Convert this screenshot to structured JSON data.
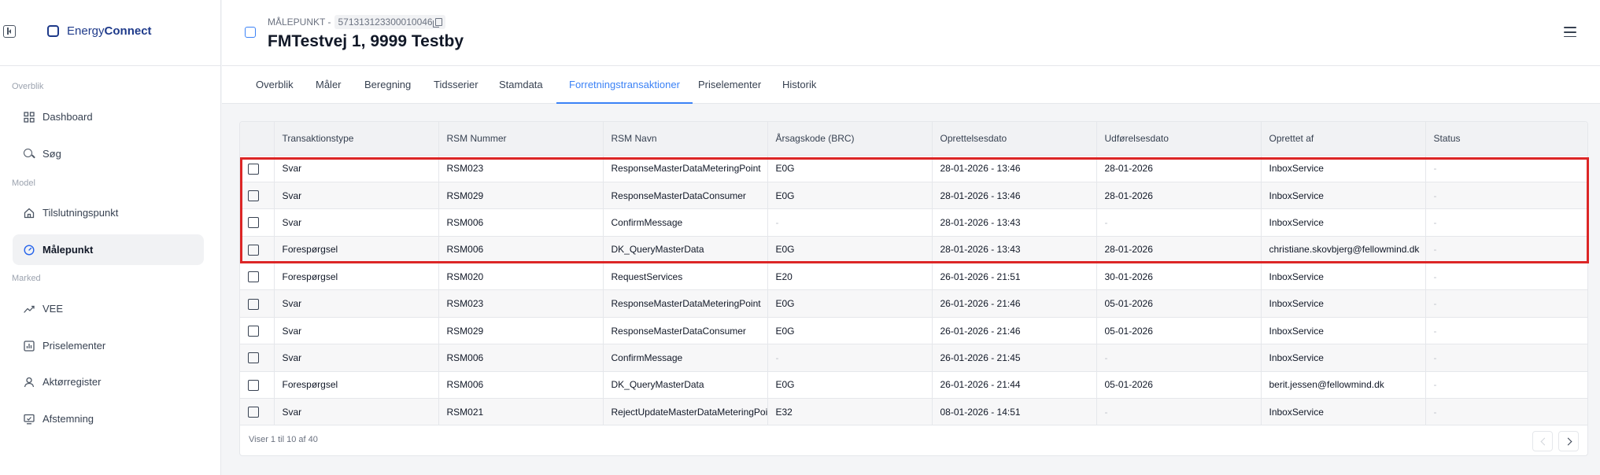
{
  "sidebar": {
    "logo": {
      "part1": "Energy",
      "part2": "Connect"
    },
    "sections": [
      {
        "label": "Overblik",
        "items": [
          {
            "label": "Dashboard",
            "icon": "grid-icon"
          },
          {
            "label": "Søg",
            "icon": "search-icon"
          }
        ]
      },
      {
        "label": "Model",
        "items": [
          {
            "label": "Tilslutningspunkt",
            "icon": "house-icon"
          },
          {
            "label": "Målepunkt",
            "icon": "gauge-icon",
            "active": true
          }
        ]
      },
      {
        "label": "Marked",
        "items": [
          {
            "label": "VEE",
            "icon": "trend-icon"
          },
          {
            "label": "Priselementer",
            "icon": "chart-icon"
          },
          {
            "label": "Aktørregister",
            "icon": "user-icon"
          },
          {
            "label": "Afstemning",
            "icon": "monitor-icon"
          }
        ]
      }
    ]
  },
  "header": {
    "kind": "MÅLEPUNKT -",
    "id": "571313123300010046",
    "title": "FMTestvej 1, 9999 Testby"
  },
  "tabs": [
    "Overblik",
    "Måler",
    "Beregning",
    "Tidsserier",
    "Stamdata",
    "Forretningstransaktioner",
    "Priselementer",
    "Historik"
  ],
  "active_tab": "Forretningstransaktioner",
  "table": {
    "columns": [
      "Transaktionstype",
      "RSM Nummer",
      "RSM Navn",
      "Årsagskode (BRC)",
      "Oprettelsesdato",
      "Udførelsesdato",
      "Oprettet af",
      "Status"
    ],
    "rows": [
      [
        "Svar",
        "RSM023",
        "ResponseMasterDataMeteringPoint",
        "E0G",
        "28-01-2026 - 13:46",
        "28-01-2026",
        "InboxService",
        "-"
      ],
      [
        "Svar",
        "RSM029",
        "ResponseMasterDataConsumer",
        "E0G",
        "28-01-2026 - 13:46",
        "28-01-2026",
        "InboxService",
        "-"
      ],
      [
        "Svar",
        "RSM006",
        "ConfirmMessage",
        "-",
        "28-01-2026 - 13:43",
        "-",
        "InboxService",
        "-"
      ],
      [
        "Forespørgsel",
        "RSM006",
        "DK_QueryMasterData",
        "E0G",
        "28-01-2026 - 13:43",
        "28-01-2026",
        "christiane.skovbjerg@fellowmind.dk",
        "-"
      ],
      [
        "Forespørgsel",
        "RSM020",
        "RequestServices",
        "E20",
        "26-01-2026 - 21:51",
        "30-01-2026",
        "InboxService",
        "-"
      ],
      [
        "Svar",
        "RSM023",
        "ResponseMasterDataMeteringPoint",
        "E0G",
        "26-01-2026 - 21:46",
        "05-01-2026",
        "InboxService",
        "-"
      ],
      [
        "Svar",
        "RSM029",
        "ResponseMasterDataConsumer",
        "E0G",
        "26-01-2026 - 21:46",
        "05-01-2026",
        "InboxService",
        "-"
      ],
      [
        "Svar",
        "RSM006",
        "ConfirmMessage",
        "-",
        "26-01-2026 - 21:45",
        "-",
        "InboxService",
        "-"
      ],
      [
        "Forespørgsel",
        "RSM006",
        "DK_QueryMasterData",
        "E0G",
        "26-01-2026 - 21:44",
        "05-01-2026",
        "berit.jessen@fellowmind.dk",
        "-"
      ],
      [
        "Svar",
        "RSM021",
        "RejectUpdateMasterDataMeteringPoint",
        "E32",
        "08-01-2026 - 14:51",
        "-",
        "InboxService",
        "-"
      ]
    ],
    "footer": "Viser 1 til 10 af 40"
  },
  "colors": {
    "accent": "#3b82f6",
    "brand": "#1e3a8a",
    "highlight": "#dc2626"
  }
}
